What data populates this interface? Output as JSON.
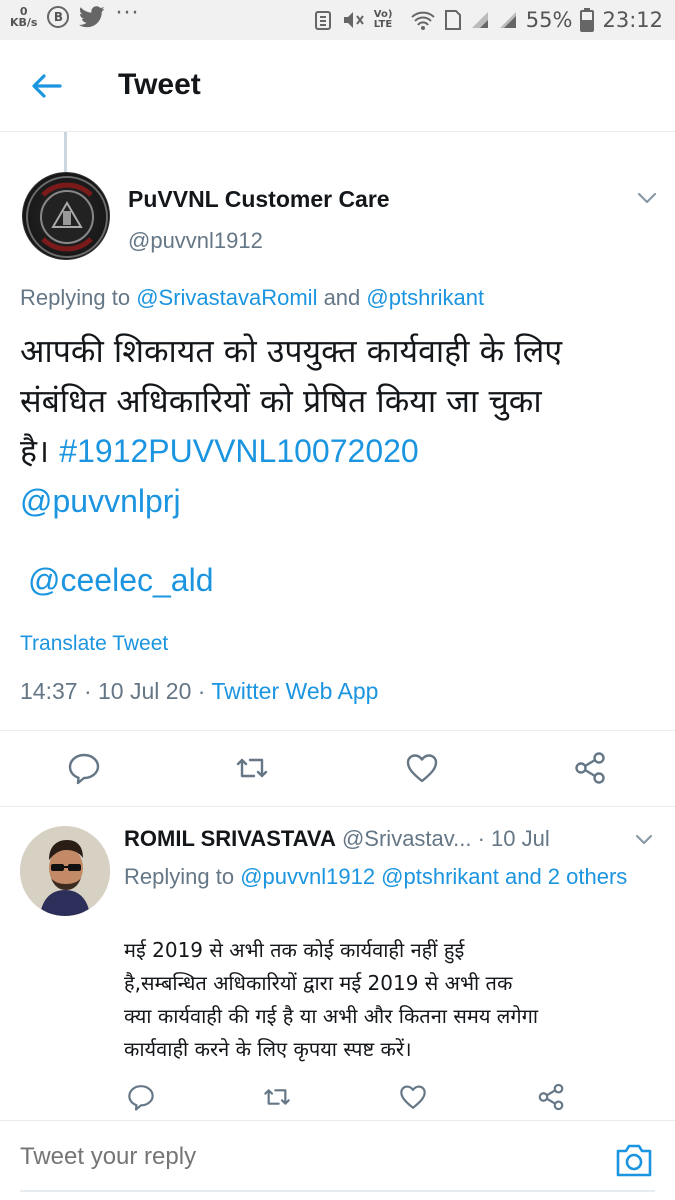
{
  "status_bar": {
    "speed_value": "0",
    "speed_unit": "KB/s",
    "b_icon_letter": "B",
    "more": "···",
    "lte": "Vo) LTE",
    "battery": "55%",
    "time": "23:12"
  },
  "appbar": {
    "title": "Tweet"
  },
  "main_tweet": {
    "name": "PuVVNL Customer Care",
    "handle": "@puvvnl1912",
    "replying_prefix": "Replying to ",
    "replying_user1": "@SrivastavaRomil",
    "replying_and": " and ",
    "replying_user2": "@ptshrikant",
    "text_line1": "आपकी शिकायत को उपयुक्त कार्यवाही के लिए",
    "text_line2": "संबंधित अधिकारियों को प्रेषित किया जा चुका",
    "text_line3_plain": "है। ",
    "hashtag": "#1912PUVVNL10072020",
    "mention1": "@puvvnlprj",
    "mention2": "@ceelec_ald",
    "translate": "Translate Tweet",
    "time": "14:37",
    "sep": " · ",
    "date": "10 Jul 20",
    "source": "Twitter Web App"
  },
  "reply_tweet": {
    "name": "ROMIL SRIVASTAVA",
    "handle": " @Srivastav...",
    "date": " · 10 Jul",
    "replying_prefix": "Replying to ",
    "replying_users": "@puvvnl1912 @ptshrikant and 2 others",
    "text_line1": "मई 2019 से अभी तक कोई कार्यवाही नहीं हुई",
    "text_line2": "है,सम्बन्धित अधिकारियों द्वारा मई 2019 से अभी तक",
    "text_line3": "क्या कार्यवाही की गई है या अभी और कितना समय लगेगा",
    "text_line4": "कार्यवाही करने के लिए कृपया स्पष्ट करें।"
  },
  "compose": {
    "placeholder": "Tweet your reply"
  },
  "colors": {
    "link": "#1b95e0",
    "secondary_text": "#657786",
    "divider": "#e6ecf0"
  },
  "icons": [
    "back-arrow-icon",
    "chevron-down-icon",
    "reply-icon",
    "retweet-icon",
    "like-icon",
    "share-icon",
    "camera-icon"
  ]
}
